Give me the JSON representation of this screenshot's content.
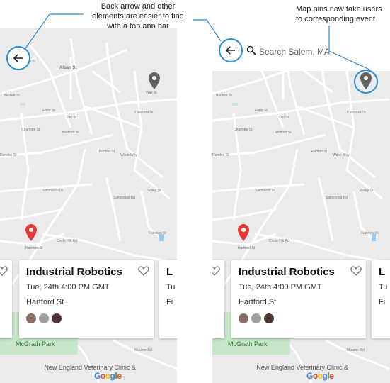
{
  "annotations": {
    "left_note": "Back arrow and other elements are easier to find with a top app bar",
    "right_note": "Map pins now take users to corresponding event"
  },
  "search": {
    "placeholder": "Search Salem, MA"
  },
  "map": {
    "streets": [
      "Alban St",
      "Fulton St",
      "Beckett St",
      "Wall St",
      "Elder St",
      "Old St",
      "Charlotte St",
      "Bedford St",
      "Crescent Dr",
      "Dundee St",
      "Saltmarsh Dr",
      "Puritan St",
      "Witch Way",
      "Valley St",
      "Saltonstall Rd",
      "Hartford St",
      "Circle Hill Rd",
      "Fairview St",
      "Mourne Rd"
    ],
    "park_label": "McGrath Park",
    "poi_label": "New England Veterinary Clinic &",
    "logo": "Google",
    "colors": {
      "background": "#ebebeb",
      "road": "#ffffff",
      "pin_red": "#e53935",
      "pin_gray": "#616161",
      "accent": "#2b8cd8"
    }
  },
  "events": [
    {
      "title": "Industrial Robotics",
      "date": "Tue, 24th 4:00 PM GMT",
      "location": "Hartford St",
      "attendees": 3
    }
  ],
  "partial_cards": {
    "right_prefix": "L",
    "right_date_prefix": "Tu",
    "right_loc_prefix": "Fi"
  },
  "icons": {
    "back": "arrow-left-icon",
    "search": "search-icon",
    "favorite": "heart-outline-icon",
    "pin": "map-pin-icon"
  }
}
